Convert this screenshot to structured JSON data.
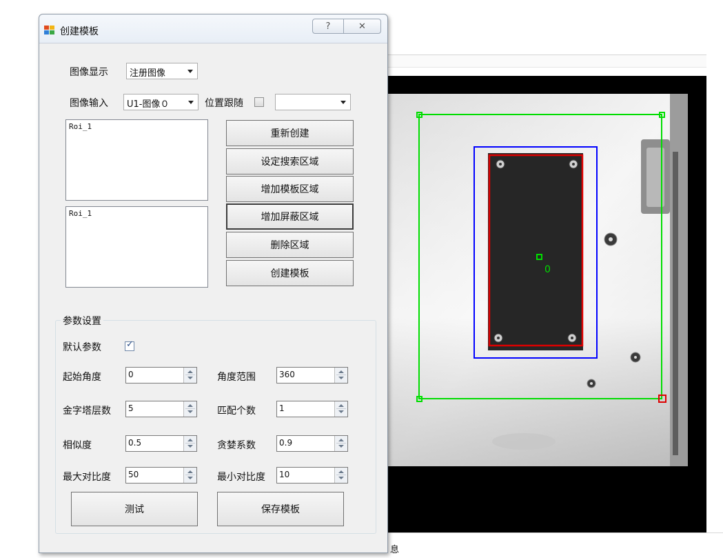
{
  "dialog": {
    "title": "创建模板",
    "help_glyph": "?",
    "close_glyph": "✕"
  },
  "form": {
    "image_display_label": "图像显示",
    "image_display_value": "注册图像",
    "image_input_label": "图像输入",
    "image_input_value": "U1-图像０",
    "position_follow_label": "位置跟随",
    "position_follow_checked": false,
    "position_follow_value": ""
  },
  "roi_lists": {
    "top_items": [
      "Roi_1"
    ],
    "bottom_items": [
      "Roi_1"
    ]
  },
  "actions": {
    "recreate": "重新创建",
    "set_search_region": "设定搜索区域",
    "add_template_region": "增加模板区域",
    "add_mask_region": "增加屏蔽区域",
    "delete_region": "删除区域",
    "create_template": "创建模板"
  },
  "params": {
    "group_title": "参数设置",
    "default_params_label": "默认参数",
    "default_params_checked": true,
    "start_angle_label": "起始角度",
    "start_angle": "0",
    "angle_range_label": "角度范围",
    "angle_range": "360",
    "pyramid_levels_label": "金字塔层数",
    "pyramid_levels": "5",
    "match_count_label": "匹配个数",
    "match_count": "1",
    "similarity_label": "相似度",
    "similarity": "0.5",
    "greedy_label": "贪婪系数",
    "greedy": "0.9",
    "max_contrast_label": "最大对比度",
    "max_contrast": "50",
    "min_contrast_label": "最小对比度",
    "min_contrast": "10"
  },
  "bottom_buttons": {
    "test": "测试",
    "save_template": "保存模板"
  },
  "viewer": {
    "center_label": "0",
    "search_region_color": "#00dd00",
    "template_region_color": "#0000ff",
    "model_color": "#dd0000"
  },
  "background": {
    "bottom_char": "息"
  }
}
